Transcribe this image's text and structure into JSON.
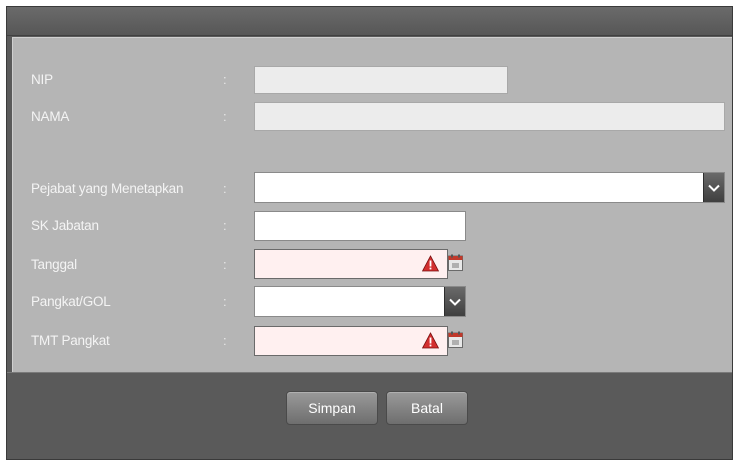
{
  "form": {
    "fields": [
      {
        "label": "NIP",
        "value": ""
      },
      {
        "label": "NAMA",
        "value": ""
      },
      {
        "label": "Pejabat yang Menetapkan",
        "value": ""
      },
      {
        "label": "SK Jabatan",
        "value": ""
      },
      {
        "label": "Tanggal",
        "value": ""
      },
      {
        "label": "Pangkat/GOL",
        "value": ""
      },
      {
        "label": "TMT Pangkat",
        "value": ""
      }
    ],
    "colon": ":"
  },
  "footer": {
    "save_label": "Simpan",
    "cancel_label": "Batal"
  },
  "colors": {
    "form_background": "#b5b5b5",
    "window_background": "#5a5a5a",
    "invalid_field": "#fff0f0",
    "warning": "#d32f2f"
  },
  "icons": {
    "dropdown": "chevron-down-icon",
    "warning": "warning-icon",
    "calendar": "calendar-icon"
  }
}
